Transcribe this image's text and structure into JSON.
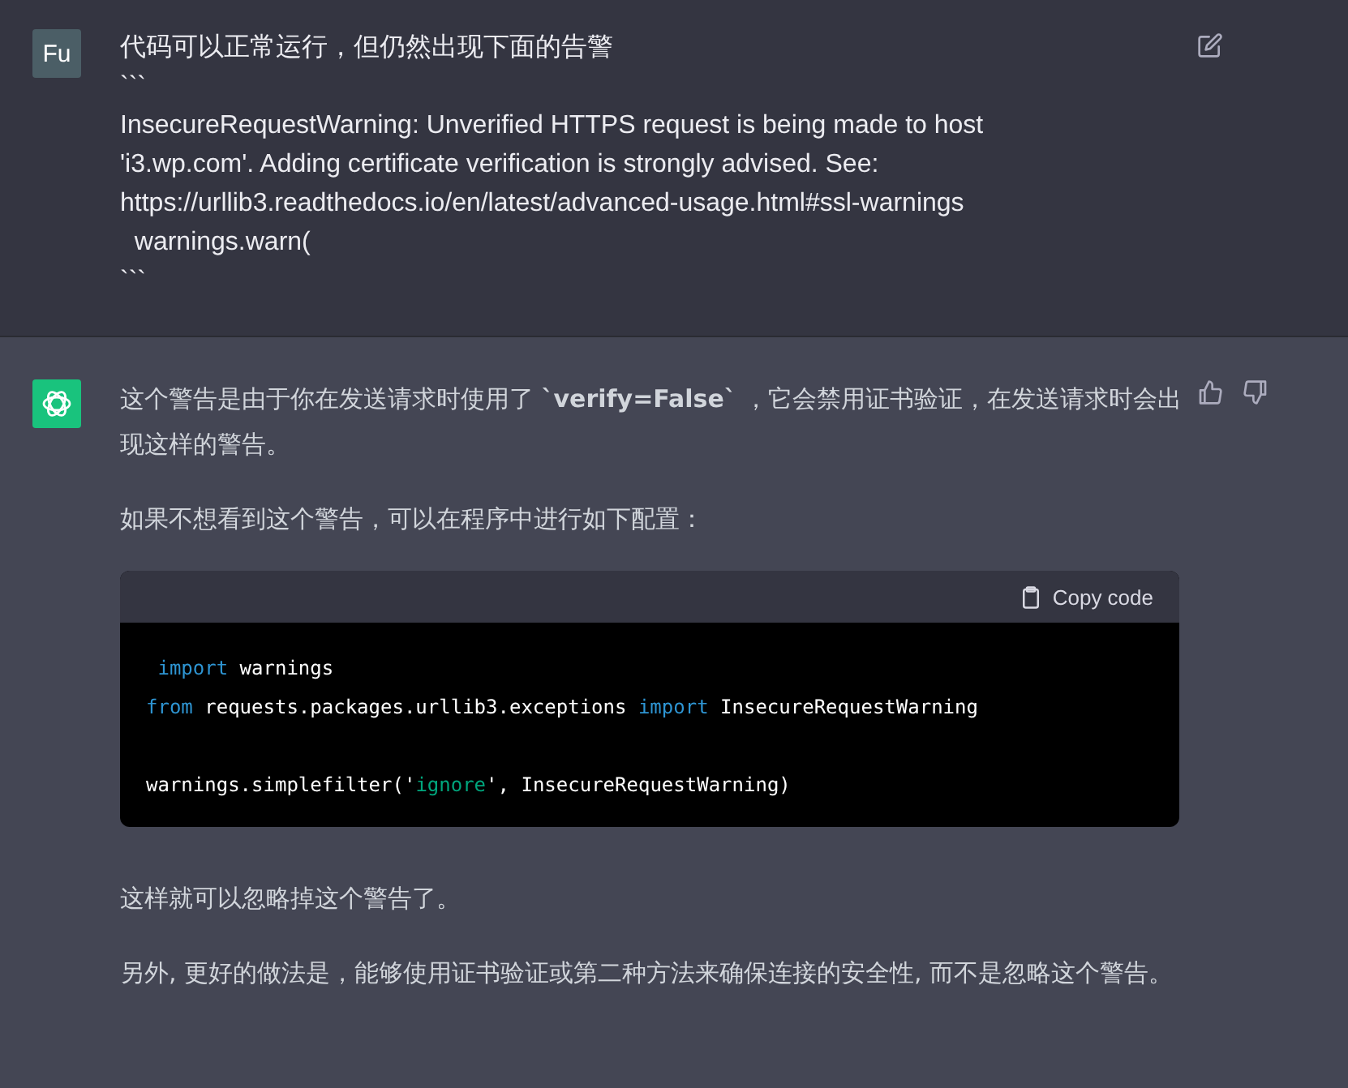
{
  "user_message": {
    "avatar": "Fu",
    "lines": [
      "代码可以正常运行，但仍然出现下面的告警",
      "```",
      "InsecureRequestWarning: Unverified HTTPS request is being made to host",
      "'i3.wp.com'. Adding certificate verification is strongly advised. See:",
      "https://urllib3.readthedocs.io/en/latest/advanced-usage.html#ssl-warnings",
      "  warnings.warn(",
      "```"
    ]
  },
  "assistant_message": {
    "paragraphs_before": [
      "这个警告是由于你在发送请求时使用了 **`verify=False`** ，它会禁用证书验证，在发送请求时会出现这样的警告。",
      "如果不想看到这个警告，可以在程序中进行如下配置："
    ],
    "code_block": {
      "copy_label": "Copy code",
      "groups": [
        [
          [
            {
              "text": " import",
              "kind": "keyword"
            },
            {
              "text": " warnings",
              "kind": "plain"
            }
          ],
          [
            {
              "text": "from",
              "kind": "keyword"
            },
            {
              "text": " requests.packages.urllib3.exceptions ",
              "kind": "plain"
            },
            {
              "text": "import",
              "kind": "keyword"
            },
            {
              "text": " InsecureRequestWarning",
              "kind": "plain"
            }
          ]
        ],
        [
          [
            {
              "text": "warnings.simplefilter(",
              "kind": "plain"
            },
            {
              "text": "'",
              "kind": "plain"
            },
            {
              "text": "ignore",
              "kind": "string"
            },
            {
              "text": "'",
              "kind": "plain"
            },
            {
              "text": ", InsecureRequestWarning)",
              "kind": "plain"
            }
          ]
        ]
      ]
    },
    "paragraphs_after": [
      "这样就可以忽略掉这个警告了。",
      "另外, 更好的做法是，能够使用证书验证或第二种方法来确保连接的安全性, 而不是忽略这个警告。"
    ]
  }
}
